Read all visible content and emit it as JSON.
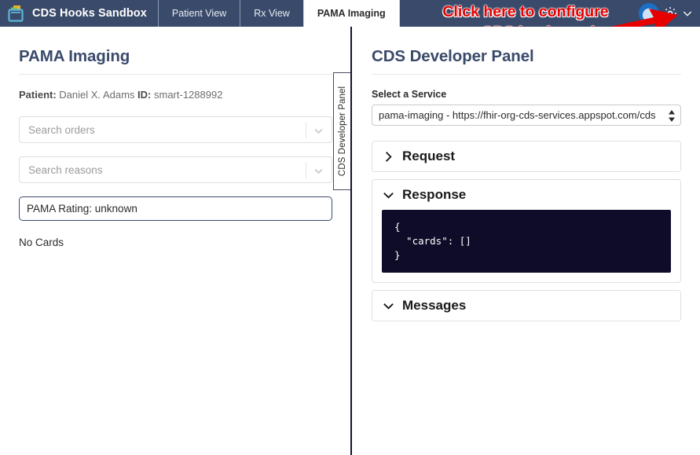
{
  "header": {
    "brand": "CDS Hooks Sandbox",
    "logo_icon": "sandbox-window-logo-icon",
    "tabs": [
      {
        "label": "Patient View",
        "active": false
      },
      {
        "label": "Rx View",
        "active": false
      },
      {
        "label": "PAMA Imaging",
        "active": true
      }
    ],
    "avatar_icon": "user-avatar",
    "gear_icon": "gear-icon",
    "caret_icon": "chevron-down-icon"
  },
  "annotation": {
    "line1": "Click here to configure",
    "line2": "a new CDS hook service.",
    "color": "#e60000",
    "arrow_icon": "red-arrow-icon"
  },
  "left_panel": {
    "title": "PAMA Imaging",
    "patient_label": "Patient:",
    "patient_name": "Daniel X. Adams",
    "id_label": "ID:",
    "patient_id": "smart-1288992",
    "orders_placeholder": "Search orders",
    "reasons_placeholder": "Search reasons",
    "rating_text": "PAMA Rating: unknown",
    "no_cards": "No Cards",
    "chevron_icon": "chevron-down-icon"
  },
  "side_tab": {
    "label": "CDS Developer Panel"
  },
  "right_panel": {
    "title": "CDS Developer Panel",
    "select_label": "Select a Service",
    "selected_service": "pama-imaging - https://fhir-org-cds-services.appspot.com/cds",
    "stepper_icon": "select-stepper-icon",
    "sections": [
      {
        "label": "Request",
        "expanded": false,
        "chevron_icon": "chevron-right-icon",
        "body": null
      },
      {
        "label": "Response",
        "expanded": true,
        "chevron_icon": "chevron-down-icon",
        "body": "{\n  \"cards\": []\n}"
      },
      {
        "label": "Messages",
        "expanded": true,
        "chevron_icon": "chevron-down-icon",
        "body": null
      }
    ]
  },
  "colors": {
    "navbar": "#3a4a6b",
    "title": "#3a4a6b",
    "code_bg": "#0e0c28",
    "annotation": "#e60000",
    "divider": "#15132e"
  }
}
